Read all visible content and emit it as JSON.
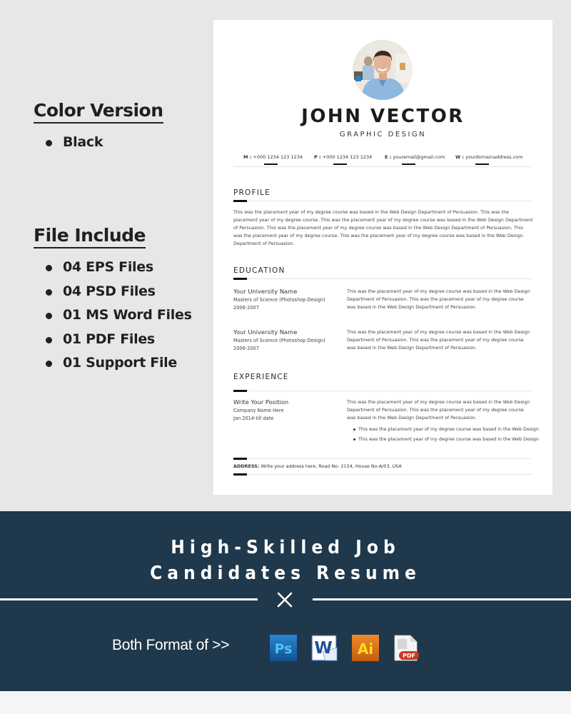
{
  "info": {
    "color_version": {
      "title": "Color Version",
      "items": [
        "Black"
      ]
    },
    "file_include": {
      "title": "File Include",
      "items": [
        "04 EPS Files",
        "04 PSD Files",
        "01 MS Word Files",
        "01 PDF Files",
        "01 Support File"
      ]
    }
  },
  "resume": {
    "name": "JOHN VECTOR",
    "role": "GRAPHIC DESIGN",
    "contacts": [
      {
        "label": "M :",
        "value": "+000 1234 123 1234"
      },
      {
        "label": "P :",
        "value": "+000 1234 123 1234"
      },
      {
        "label": "E :",
        "value": "youremail@gmail.com"
      },
      {
        "label": "W :",
        "value": "yourdomainaddress.com"
      }
    ],
    "profile": {
      "title": "PROFILE",
      "text": "This was the placement year of my degree course  was based in the Web Design Department of  Persuasion. This was the placement year of my degree course. This was the placement year of my degree course  was based in the Web Design Department of  Persuasion. This was the placement year of my degree course  was based in the Web Design Department of  Persuasion. This was the placement year of my degree course. This was the placement year of my degree course  was based in the Web Design Department of  Persuasion."
    },
    "education": {
      "title": "EDUCATION",
      "entries": [
        {
          "school": "Your University Name",
          "degree": "Masters of Science (Photoshop Design)",
          "years": "2006-2007",
          "text": "This was the placement year of my degree course  was based in the Web Design Department of  Persuasion. This was the placement year of my degree course  was based in the Web Design Department of  Persuasion."
        },
        {
          "school": "Your University Name",
          "degree": "Masters of Science (Photoshop Design)",
          "years": "2006-2007",
          "text": "This was the placement year of my degree course  was based in the Web Design Department of  Persuasion. This was the placement year of my degree course  was based in the Web Design Department of  Persuasion."
        }
      ]
    },
    "experience": {
      "title": "EXPERIENCE",
      "position": "Write Your Position",
      "company": "Company Name Here",
      "dates": "Jan 2014-till date",
      "text": "This was the placement year of my degree course  was based in the Web Design Department of  Persuasion. This was the placement year of my degree course  was based in the Web Design Department of  Persuasion.",
      "bullets": [
        "This was the placement year of my degree course  was based in the Web Design",
        "This was the placement year of my degree course  was based in the Web Design"
      ]
    },
    "address": {
      "label": "ADDRESS:",
      "value": "Write your address here, Road No- 2154, House No-A/03, USA"
    }
  },
  "banner": {
    "headline_line1": "High-Skilled Job",
    "headline_line2": "Candidates Resume",
    "formats_label": "Both Format of >>",
    "formats": [
      {
        "icon": "photoshop-icon",
        "text": "Ps",
        "color": "#1c6fb5"
      },
      {
        "icon": "word-icon",
        "text": "W",
        "color": "#1d4fa0"
      },
      {
        "icon": "illustrator-icon",
        "text": "Ai",
        "color": "#e07a22"
      },
      {
        "icon": "pdf-icon",
        "text": "PDF",
        "color": "#c9381e"
      }
    ],
    "background": "#1f384b"
  }
}
